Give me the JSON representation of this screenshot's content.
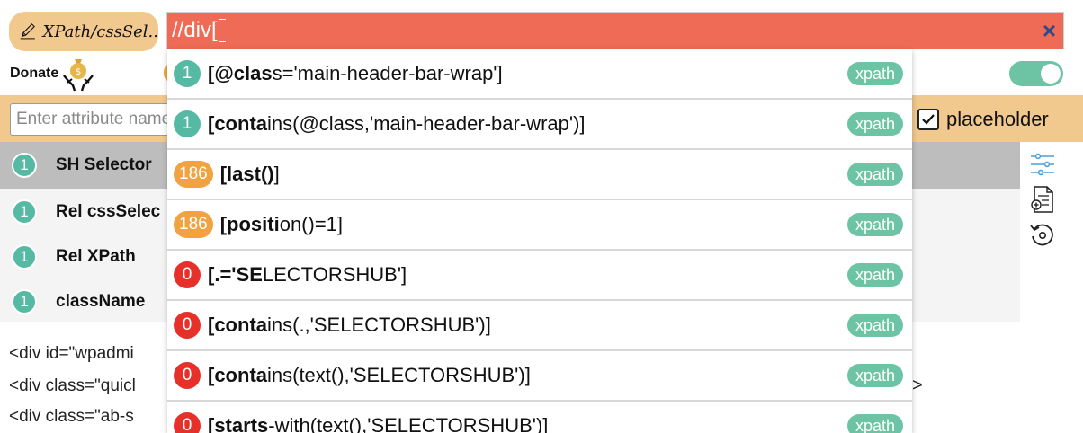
{
  "header": {
    "mode_label": "XPath/cssSel..",
    "search_value": "//div[",
    "clear_label": "×",
    "donate_label": "Donate"
  },
  "attributes": {
    "placeholder": "Enter attribute name",
    "checkbox_label": "placeholder",
    "checkbox_checked": true
  },
  "selectors": [
    {
      "count": "1",
      "name": "SH Selector",
      "active": true
    },
    {
      "count": "1",
      "name": "Rel cssSelec",
      "active": false
    },
    {
      "count": "1",
      "name": "Rel XPath",
      "active": false
    },
    {
      "count": "1",
      "name": "className",
      "active": false
    }
  ],
  "dom_lines": [
    "<div id=\"wpadmi",
    "<div class=\"quicl",
    "<div class=\"ab-s"
  ],
  "dom_tail": ">",
  "suggestions": [
    {
      "count": "1",
      "color": "green",
      "bold": "[@clas",
      "rest": "s='main-header-bar-wrap']",
      "tag": "xpath"
    },
    {
      "count": "1",
      "color": "green",
      "bold": "[conta",
      "rest": "ins(@class,'main-header-bar-wrap')]",
      "tag": "xpath"
    },
    {
      "count": "186",
      "color": "orange",
      "bold": "[last()",
      "rest": "]",
      "tag": "xpath"
    },
    {
      "count": "186",
      "color": "orange",
      "bold": "[positi",
      "rest": "on()=1]",
      "tag": "xpath"
    },
    {
      "count": "0",
      "color": "red",
      "bold": "[.='SE",
      "rest": "LECTORSHUB']",
      "tag": "xpath"
    },
    {
      "count": "0",
      "color": "red",
      "bold": "[conta",
      "rest": "ins(.,'SELECTORSHUB')]",
      "tag": "xpath"
    },
    {
      "count": "0",
      "color": "red",
      "bold": "[conta",
      "rest": "ins(text(),'SELECTORSHUB')]",
      "tag": "xpath"
    },
    {
      "count": "0",
      "color": "red",
      "bold": "[starts",
      "rest": "-with(text(),'SELECTORSHUB')]",
      "tag": "xpath"
    }
  ],
  "colors": {
    "search_bg": "#ef6b55",
    "accent_orange": "#f1c88d",
    "badge_green": "#55b9a4",
    "badge_orange": "#f0a340",
    "badge_red": "#e8302a",
    "tag_green": "#6cc4a4"
  }
}
